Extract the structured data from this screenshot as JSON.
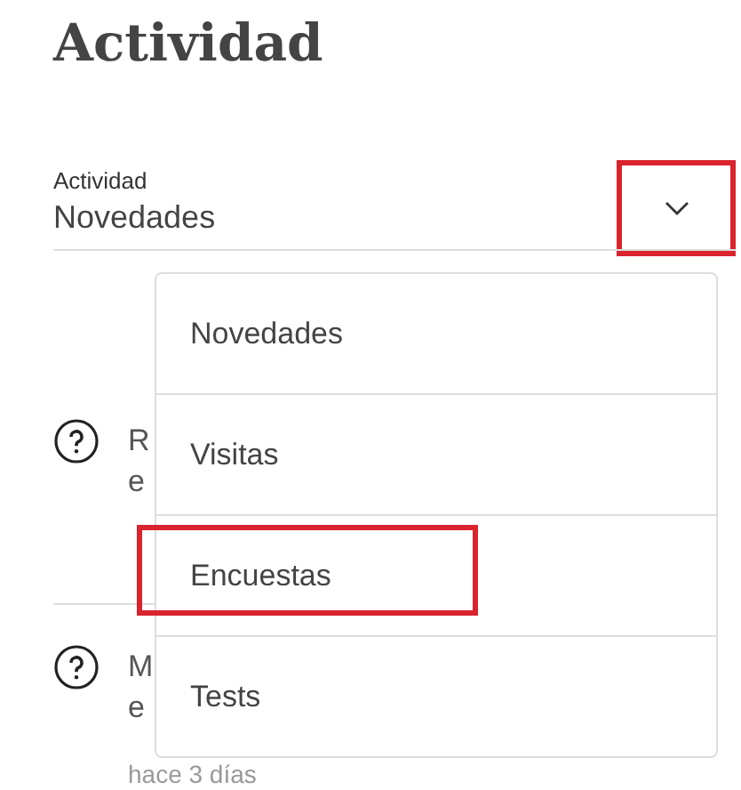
{
  "title": "Actividad",
  "select": {
    "label": "Actividad",
    "value": "Novedades",
    "expanded": true,
    "highlighted": true
  },
  "options": [
    {
      "label": "Novedades",
      "highlighted": false
    },
    {
      "label": "Visitas",
      "highlighted": false
    },
    {
      "label": "Encuestas",
      "highlighted": true
    },
    {
      "label": "Tests",
      "highlighted": false
    }
  ],
  "feed": [
    {
      "lines": [
        "R",
        "e"
      ]
    },
    {
      "lines": [
        "M",
        "e"
      ],
      "time": "hace 3 días"
    }
  ]
}
